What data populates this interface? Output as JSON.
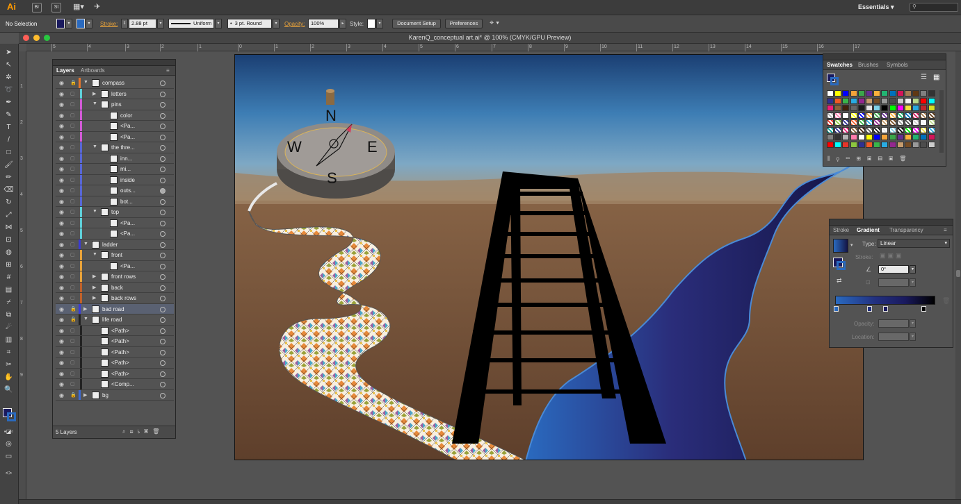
{
  "app": {
    "logo": "Ai",
    "workspace": "Essentials",
    "menubar_buttons": [
      "Br",
      "St"
    ]
  },
  "control_bar": {
    "selection_status": "No Selection",
    "stroke_label": "Stroke:",
    "stroke_weight": "2.88 pt",
    "profile": "Uniform",
    "brush": "3 pt. Round",
    "opacity_label": "Opacity:",
    "opacity_value": "100%",
    "style_label": "Style:",
    "document_setup": "Document Setup",
    "preferences": "Preferences"
  },
  "document": {
    "title": "KarenQ_conceptual art.ai* @ 100% (CMYK/GPU Preview)"
  },
  "ruler_h_ticks": [
    "5",
    "4",
    "3",
    "2",
    "1",
    "0",
    "1",
    "2",
    "3",
    "4",
    "5",
    "6",
    "7",
    "8",
    "9",
    "10",
    "11",
    "12",
    "13",
    "14",
    "15",
    "16",
    "17"
  ],
  "ruler_v_ticks": [
    "1",
    "2",
    "3",
    "4",
    "5",
    "6",
    "7",
    "8",
    "9"
  ],
  "layers_panel": {
    "tabs": [
      "Layers",
      "Artboards"
    ],
    "footer": "5 Layers",
    "rows": [
      {
        "name": "compass",
        "level": 0,
        "expanded": true,
        "color": "#e8772a"
      },
      {
        "name": "letters",
        "level": 1,
        "expanded": false,
        "color": "#5fd0d9"
      },
      {
        "name": "pins",
        "level": 1,
        "expanded": true,
        "color": "#d25ad6"
      },
      {
        "name": "color",
        "level": 2,
        "color": "#d25ad6"
      },
      {
        "name": "<Pa...",
        "level": 2,
        "color": "#d25ad6"
      },
      {
        "name": "<Pa...",
        "level": 2,
        "color": "#d25ad6"
      },
      {
        "name": "the thre...",
        "level": 1,
        "expanded": true,
        "color": "#5867d6"
      },
      {
        "name": "inn...",
        "level": 2,
        "color": "#5867d6"
      },
      {
        "name": "mi...",
        "level": 2,
        "color": "#5867d6"
      },
      {
        "name": "inside",
        "level": 2,
        "color": "#5867d6"
      },
      {
        "name": "outs...",
        "level": 2,
        "color": "#5867d6"
      },
      {
        "name": "bot...",
        "level": 2,
        "color": "#5867d6"
      },
      {
        "name": "top",
        "level": 1,
        "expanded": true,
        "color": "#5fd0d9"
      },
      {
        "name": "<Pa...",
        "level": 2,
        "color": "#5fd0d9"
      },
      {
        "name": "<Pa...",
        "level": 2,
        "color": "#5fd0d9"
      },
      {
        "name": "ladder",
        "level": 0,
        "expanded": true,
        "color": "#3a3ad6"
      },
      {
        "name": "front",
        "level": 1,
        "expanded": true,
        "color": "#e8a23a"
      },
      {
        "name": "<Pa...",
        "level": 2,
        "color": "#e8a23a"
      },
      {
        "name": "front rows",
        "level": 1,
        "expanded": false,
        "color": "#e8a23a"
      },
      {
        "name": "back",
        "level": 1,
        "expanded": false,
        "color": "#c0612a"
      },
      {
        "name": "back rows",
        "level": 1,
        "expanded": false,
        "color": "#c0612a"
      },
      {
        "name": "bad road",
        "level": 0,
        "expanded": false,
        "color": "#3a3ad6",
        "selected": true
      },
      {
        "name": "life road",
        "level": 0,
        "expanded": true,
        "color": "#222222"
      },
      {
        "name": "<Path>",
        "level": 1,
        "color": "#222222"
      },
      {
        "name": "<Path>",
        "level": 1,
        "color": "#222222"
      },
      {
        "name": "<Path>",
        "level": 1,
        "color": "#222222"
      },
      {
        "name": "<Path>",
        "level": 1,
        "color": "#222222"
      },
      {
        "name": "<Path>",
        "level": 1,
        "color": "#222222"
      },
      {
        "name": "<Comp...",
        "level": 1,
        "color": "#222222"
      },
      {
        "name": "bg",
        "level": 0,
        "expanded": false,
        "color": "#3a6ad6"
      }
    ]
  },
  "swatches_panel": {
    "tabs": [
      "Swatches",
      "Brushes",
      "Symbols"
    ]
  },
  "gradient_panel": {
    "tabs": [
      "Stroke",
      "Gradient",
      "Transparency"
    ],
    "type_label": "Type:",
    "type_value": "Linear",
    "stroke_label": "Stroke:",
    "angle": "0°",
    "opacity_label": "Opacity:",
    "location_label": "Location:"
  },
  "artwork": {
    "compass_letters": [
      "N",
      "E",
      "S",
      "W"
    ]
  }
}
